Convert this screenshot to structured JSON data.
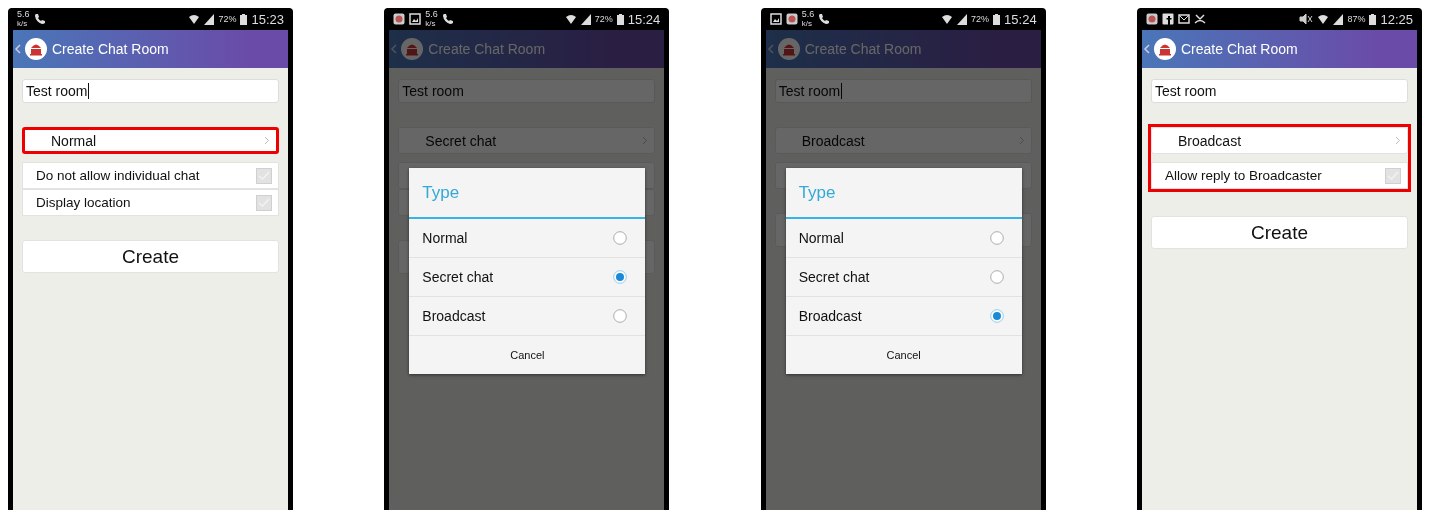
{
  "phones": [
    {
      "status_bar": {
        "notifications": [
          {
            "kind": "speed",
            "value": "5.6",
            "unit": "k/s"
          },
          {
            "kind": "call"
          }
        ],
        "muted": false,
        "battery": "72%",
        "time": "15:23"
      },
      "app_bar": {
        "title": "Create Chat Room"
      },
      "room_name": {
        "value": "Test room",
        "cursor": true
      },
      "settings": {
        "highlighted": false,
        "type_selector": {
          "value": "Normal",
          "highlighted": true
        },
        "options": [
          {
            "label": "Do not allow individual chat",
            "checked": false
          },
          {
            "label": "Display location",
            "checked": false
          }
        ]
      },
      "create_button": "Create"
    },
    {
      "status_bar": {
        "notifications": [
          {
            "kind": "app"
          },
          {
            "kind": "image"
          },
          {
            "kind": "speed",
            "value": "5.6",
            "unit": "k/s"
          },
          {
            "kind": "call"
          }
        ],
        "muted": false,
        "battery": "72%",
        "time": "15:24"
      },
      "app_bar": {
        "title": "Create Chat Room"
      },
      "room_name": {
        "value": "Test room",
        "cursor": false
      },
      "settings": {
        "highlighted": false,
        "type_selector": {
          "value": "Secret chat",
          "highlighted": false
        }
      },
      "covered_rows": [
        {
          "kind": "option"
        },
        {
          "kind": "option"
        },
        {
          "kind": "button"
        }
      ],
      "dialog": {
        "title": "Type",
        "options": [
          {
            "label": "Normal",
            "selected": false
          },
          {
            "label": "Secret chat",
            "selected": true
          },
          {
            "label": "Broadcast",
            "selected": false
          }
        ],
        "cancel": "Cancel"
      }
    },
    {
      "status_bar": {
        "notifications": [
          {
            "kind": "image"
          },
          {
            "kind": "app"
          },
          {
            "kind": "speed",
            "value": "5.6",
            "unit": "k/s"
          },
          {
            "kind": "call"
          }
        ],
        "muted": false,
        "battery": "72%",
        "time": "15:24"
      },
      "app_bar": {
        "title": "Create Chat Room"
      },
      "room_name": {
        "value": "Test room",
        "cursor": true
      },
      "settings": {
        "highlighted": false,
        "type_selector": {
          "value": "Broadcast",
          "highlighted": false
        }
      },
      "covered_rows": [
        {
          "kind": "option"
        },
        {
          "kind": "button"
        }
      ],
      "dialog": {
        "title": "Type",
        "options": [
          {
            "label": "Normal",
            "selected": false
          },
          {
            "label": "Secret chat",
            "selected": false
          },
          {
            "label": "Broadcast",
            "selected": true
          }
        ],
        "cancel": "Cancel"
      }
    },
    {
      "status_bar": {
        "notifications": [
          {
            "kind": "app"
          },
          {
            "kind": "square"
          },
          {
            "kind": "mail"
          },
          {
            "kind": "missed"
          }
        ],
        "muted": true,
        "battery": "87%",
        "time": "12:25"
      },
      "app_bar": {
        "title": "Create Chat Room"
      },
      "room_name": {
        "value": "Test room",
        "cursor": false
      },
      "settings": {
        "highlighted": true,
        "type_selector": {
          "value": "Broadcast",
          "highlighted": false
        },
        "options": [
          {
            "label": "Allow reply to Broadcaster",
            "checked": false
          }
        ]
      },
      "create_button": "Create"
    }
  ]
}
